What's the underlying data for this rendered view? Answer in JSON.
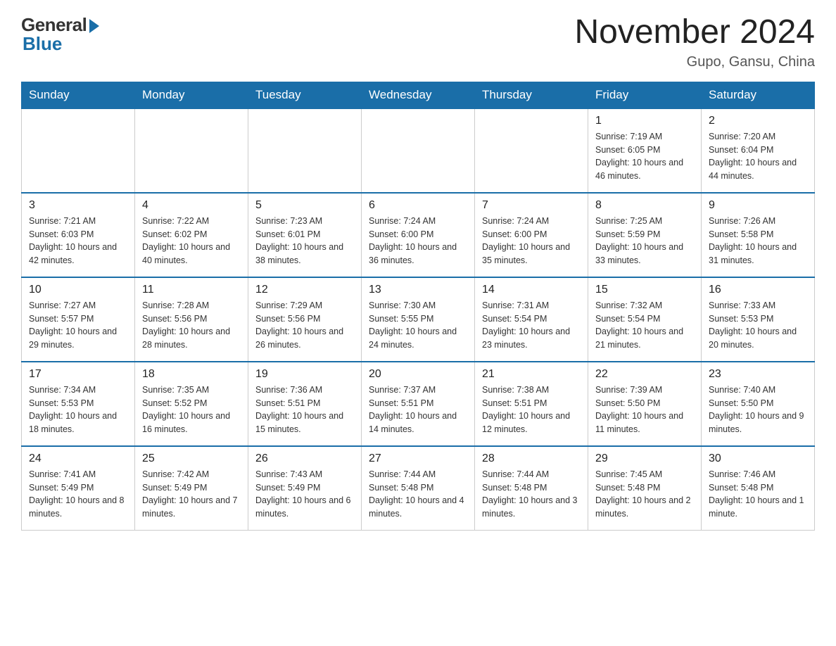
{
  "logo": {
    "general": "General",
    "blue": "Blue"
  },
  "title": {
    "month": "November 2024",
    "location": "Gupo, Gansu, China"
  },
  "weekdays": [
    "Sunday",
    "Monday",
    "Tuesday",
    "Wednesday",
    "Thursday",
    "Friday",
    "Saturday"
  ],
  "weeks": [
    [
      {
        "day": "",
        "info": ""
      },
      {
        "day": "",
        "info": ""
      },
      {
        "day": "",
        "info": ""
      },
      {
        "day": "",
        "info": ""
      },
      {
        "day": "",
        "info": ""
      },
      {
        "day": "1",
        "info": "Sunrise: 7:19 AM\nSunset: 6:05 PM\nDaylight: 10 hours and 46 minutes."
      },
      {
        "day": "2",
        "info": "Sunrise: 7:20 AM\nSunset: 6:04 PM\nDaylight: 10 hours and 44 minutes."
      }
    ],
    [
      {
        "day": "3",
        "info": "Sunrise: 7:21 AM\nSunset: 6:03 PM\nDaylight: 10 hours and 42 minutes."
      },
      {
        "day": "4",
        "info": "Sunrise: 7:22 AM\nSunset: 6:02 PM\nDaylight: 10 hours and 40 minutes."
      },
      {
        "day": "5",
        "info": "Sunrise: 7:23 AM\nSunset: 6:01 PM\nDaylight: 10 hours and 38 minutes."
      },
      {
        "day": "6",
        "info": "Sunrise: 7:24 AM\nSunset: 6:00 PM\nDaylight: 10 hours and 36 minutes."
      },
      {
        "day": "7",
        "info": "Sunrise: 7:24 AM\nSunset: 6:00 PM\nDaylight: 10 hours and 35 minutes."
      },
      {
        "day": "8",
        "info": "Sunrise: 7:25 AM\nSunset: 5:59 PM\nDaylight: 10 hours and 33 minutes."
      },
      {
        "day": "9",
        "info": "Sunrise: 7:26 AM\nSunset: 5:58 PM\nDaylight: 10 hours and 31 minutes."
      }
    ],
    [
      {
        "day": "10",
        "info": "Sunrise: 7:27 AM\nSunset: 5:57 PM\nDaylight: 10 hours and 29 minutes."
      },
      {
        "day": "11",
        "info": "Sunrise: 7:28 AM\nSunset: 5:56 PM\nDaylight: 10 hours and 28 minutes."
      },
      {
        "day": "12",
        "info": "Sunrise: 7:29 AM\nSunset: 5:56 PM\nDaylight: 10 hours and 26 minutes."
      },
      {
        "day": "13",
        "info": "Sunrise: 7:30 AM\nSunset: 5:55 PM\nDaylight: 10 hours and 24 minutes."
      },
      {
        "day": "14",
        "info": "Sunrise: 7:31 AM\nSunset: 5:54 PM\nDaylight: 10 hours and 23 minutes."
      },
      {
        "day": "15",
        "info": "Sunrise: 7:32 AM\nSunset: 5:54 PM\nDaylight: 10 hours and 21 minutes."
      },
      {
        "day": "16",
        "info": "Sunrise: 7:33 AM\nSunset: 5:53 PM\nDaylight: 10 hours and 20 minutes."
      }
    ],
    [
      {
        "day": "17",
        "info": "Sunrise: 7:34 AM\nSunset: 5:53 PM\nDaylight: 10 hours and 18 minutes."
      },
      {
        "day": "18",
        "info": "Sunrise: 7:35 AM\nSunset: 5:52 PM\nDaylight: 10 hours and 16 minutes."
      },
      {
        "day": "19",
        "info": "Sunrise: 7:36 AM\nSunset: 5:51 PM\nDaylight: 10 hours and 15 minutes."
      },
      {
        "day": "20",
        "info": "Sunrise: 7:37 AM\nSunset: 5:51 PM\nDaylight: 10 hours and 14 minutes."
      },
      {
        "day": "21",
        "info": "Sunrise: 7:38 AM\nSunset: 5:51 PM\nDaylight: 10 hours and 12 minutes."
      },
      {
        "day": "22",
        "info": "Sunrise: 7:39 AM\nSunset: 5:50 PM\nDaylight: 10 hours and 11 minutes."
      },
      {
        "day": "23",
        "info": "Sunrise: 7:40 AM\nSunset: 5:50 PM\nDaylight: 10 hours and 9 minutes."
      }
    ],
    [
      {
        "day": "24",
        "info": "Sunrise: 7:41 AM\nSunset: 5:49 PM\nDaylight: 10 hours and 8 minutes."
      },
      {
        "day": "25",
        "info": "Sunrise: 7:42 AM\nSunset: 5:49 PM\nDaylight: 10 hours and 7 minutes."
      },
      {
        "day": "26",
        "info": "Sunrise: 7:43 AM\nSunset: 5:49 PM\nDaylight: 10 hours and 6 minutes."
      },
      {
        "day": "27",
        "info": "Sunrise: 7:44 AM\nSunset: 5:48 PM\nDaylight: 10 hours and 4 minutes."
      },
      {
        "day": "28",
        "info": "Sunrise: 7:44 AM\nSunset: 5:48 PM\nDaylight: 10 hours and 3 minutes."
      },
      {
        "day": "29",
        "info": "Sunrise: 7:45 AM\nSunset: 5:48 PM\nDaylight: 10 hours and 2 minutes."
      },
      {
        "day": "30",
        "info": "Sunrise: 7:46 AM\nSunset: 5:48 PM\nDaylight: 10 hours and 1 minute."
      }
    ]
  ]
}
